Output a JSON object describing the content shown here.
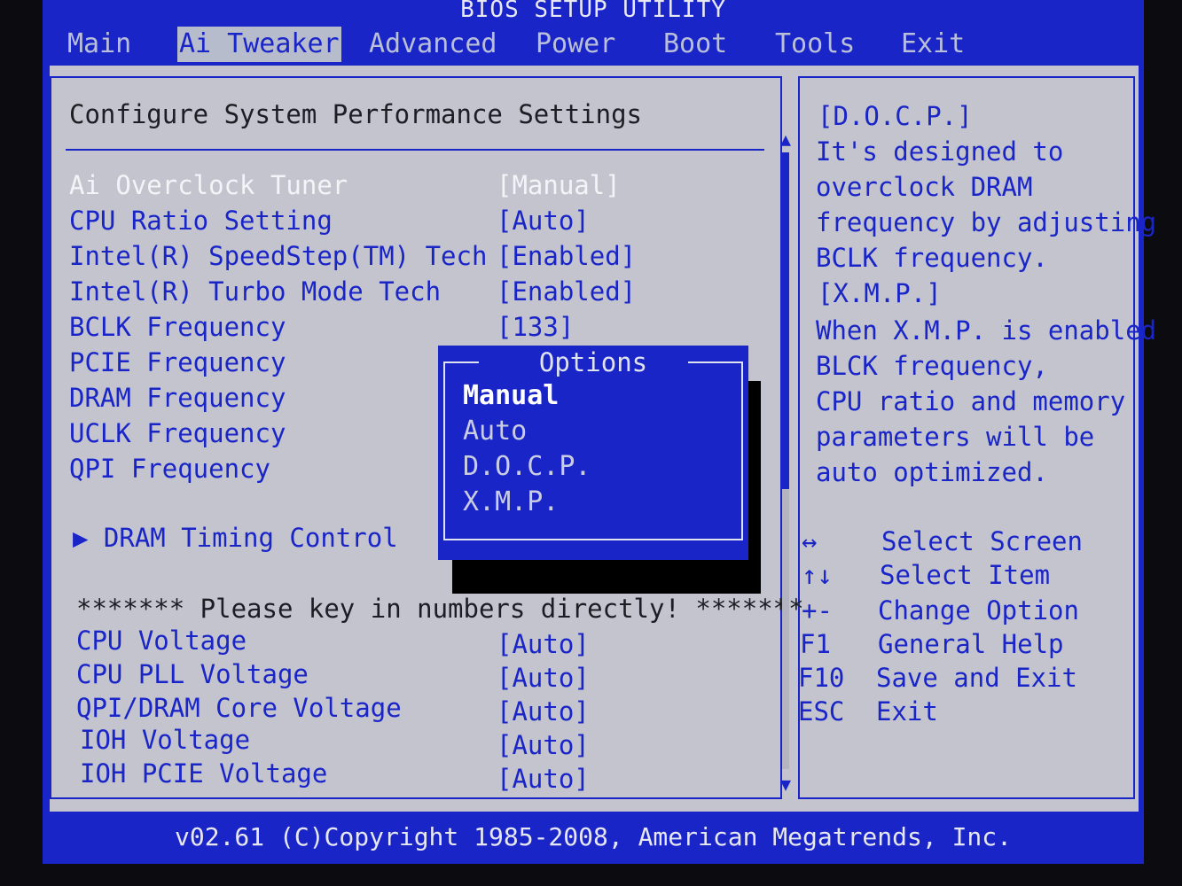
{
  "title": "BIOS SETUP UTILITY",
  "menu": [
    {
      "label": "Main",
      "active": false
    },
    {
      "label": "Ai Tweaker",
      "active": true
    },
    {
      "label": "Advanced",
      "active": false
    },
    {
      "label": "Power",
      "active": false
    },
    {
      "label": "Boot",
      "active": false
    },
    {
      "label": "Tools",
      "active": false
    },
    {
      "label": "Exit",
      "active": false
    }
  ],
  "main": {
    "heading": "Configure System Performance Settings",
    "settings": [
      {
        "label": "Ai Overclock Tuner",
        "value": "[Manual]"
      },
      {
        "label": "CPU Ratio Setting",
        "value": "[Auto]"
      },
      {
        "label": "Intel(R) SpeedStep(TM) Tech",
        "value": "[Enabled]"
      },
      {
        "label": "Intel(R) Turbo Mode Tech",
        "value": "[Enabled]"
      },
      {
        "label": "BCLK Frequency",
        "value": "[133]"
      },
      {
        "label": "PCIE Frequency",
        "value": ""
      },
      {
        "label": "DRAM Frequency",
        "value": ""
      },
      {
        "label": "UCLK Frequency",
        "value": ""
      },
      {
        "label": "QPI Frequency",
        "value": ""
      }
    ],
    "submenu": "▶ DRAM Timing Control",
    "note": "******* Please key in numbers directly! *******",
    "voltages": [
      {
        "label": "CPU Voltage",
        "value": "[Auto]"
      },
      {
        "label": "CPU PLL Voltage",
        "value": "[Auto]"
      },
      {
        "label": "QPI/DRAM Core Voltage",
        "value": "[Auto]"
      },
      {
        "label": "IOH Voltage",
        "value": "[Auto]"
      },
      {
        "label": "IOH PCIE Voltage",
        "value": "[Auto]"
      }
    ]
  },
  "popup": {
    "title": "Options",
    "options": [
      "Manual",
      "Auto",
      "D.O.C.P.",
      "X.M.P."
    ],
    "selected_index": 0
  },
  "help": {
    "lines": [
      "[D.O.C.P.]",
      "It's designed to",
      "overclock DRAM",
      "frequency by adjusting",
      "BCLK frequency.",
      "[X.M.P.]",
      "When X.M.P. is enabled",
      "BLCK frequency,",
      "CPU ratio and memory",
      "parameters will be",
      "auto optimized."
    ],
    "keys": [
      {
        "key": "↔",
        "action": "Select Screen"
      },
      {
        "key": "↑↓",
        "action": "Select Item"
      },
      {
        "key": "+-",
        "action": "Change Option"
      },
      {
        "key": "F1",
        "action": "General Help"
      },
      {
        "key": "F10",
        "action": "Save and Exit"
      },
      {
        "key": "ESC",
        "action": "Exit"
      }
    ]
  },
  "footer": "v02.61 (C)Copyright 1985-2008, American Megatrends, Inc."
}
